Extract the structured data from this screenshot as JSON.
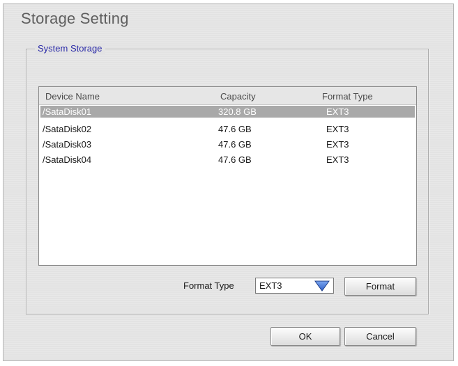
{
  "window": {
    "title": "Storage Setting"
  },
  "group": {
    "legend": "System Storage"
  },
  "list": {
    "columns": [
      "Device Name",
      "Capacity",
      "Format Type"
    ],
    "rows": [
      {
        "name": "/SataDisk01",
        "capacity": "320.8 GB",
        "format": "EXT3",
        "selected": true
      },
      {
        "name": "/SataDisk02",
        "capacity": "47.6 GB",
        "format": "EXT3",
        "selected": false
      },
      {
        "name": "/SataDisk03",
        "capacity": "47.6 GB",
        "format": "EXT3",
        "selected": false
      },
      {
        "name": "/SataDisk04",
        "capacity": "47.6 GB",
        "format": "EXT3",
        "selected": false
      }
    ]
  },
  "format_control": {
    "label": "Format Type",
    "selected_value": "EXT3",
    "button_label": "Format"
  },
  "buttons": {
    "ok": "OK",
    "cancel": "Cancel"
  },
  "icons": {
    "dropdown": "chevron-down-icon"
  },
  "colors": {
    "legend_text": "#2b2ba8",
    "selected_row": "#a9a9a9",
    "dropdown_arrow": "#3a6fd8"
  }
}
